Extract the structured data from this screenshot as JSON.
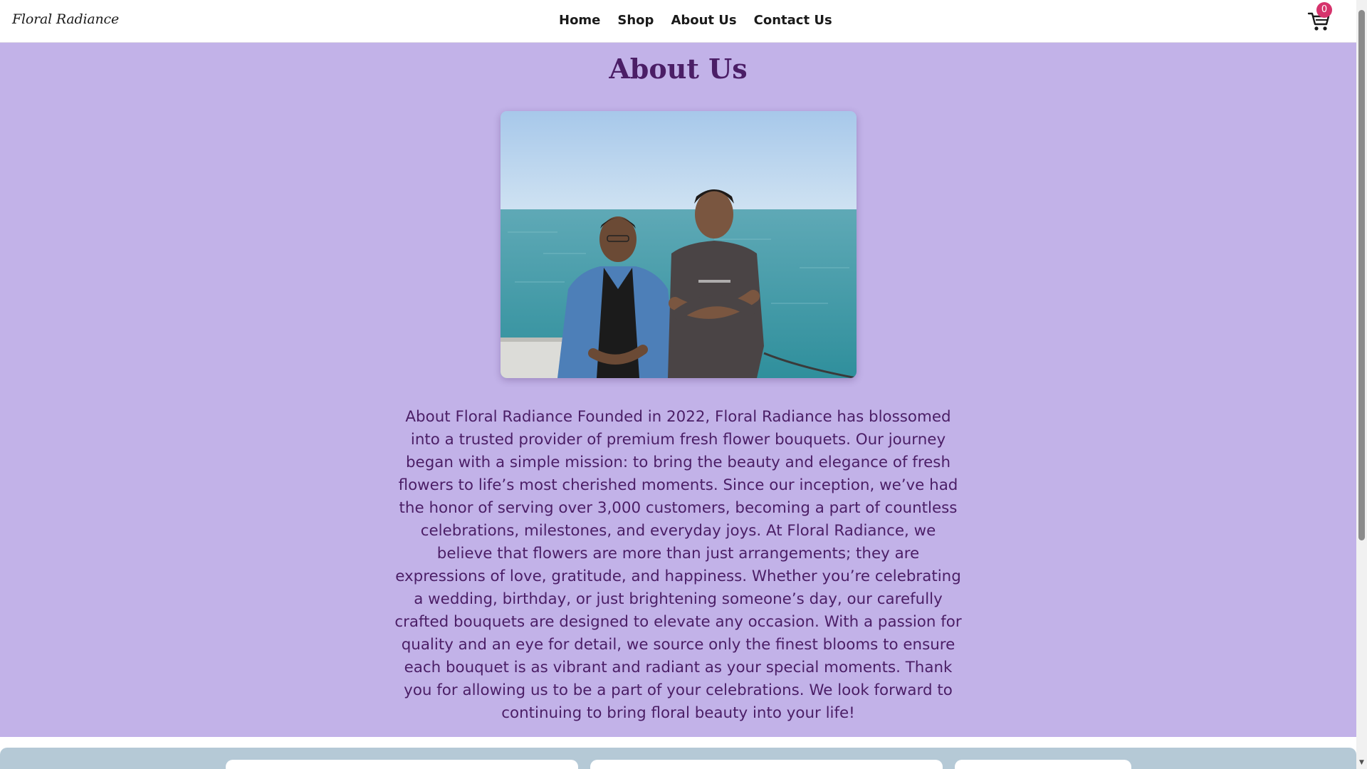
{
  "header": {
    "logo": "Floral Radiance",
    "nav": [
      "Home",
      "Shop",
      "About Us",
      "Contact Us"
    ],
    "cart_count": "0"
  },
  "about": {
    "title": "About Us",
    "photo_icon": "team-photo",
    "text": "About Floral Radiance Founded in 2022, Floral Radiance has blossomed into a trusted provider of premium fresh flower bouquets. Our journey began with a simple mission: to bring the beauty and elegance of fresh flowers to life’s most cherished moments. Since our inception, we’ve had the honor of serving over 3,000 customers, becoming a part of countless celebrations, milestones, and everyday joys. At Floral Radiance, we believe that flowers are more than just arrangements; they are expressions of love, gratitude, and happiness. Whether you’re celebrating a wedding, birthday, or just brightening someone’s day, our carefully crafted bouquets are designed to elevate any occasion. With a passion for quality and an eye for detail, we source only the finest blooms to ensure each bouquet is as vibrant and radiant as your special moments. Thank you for allowing us to be a part of your celebrations. We look forward to continuing to bring floral beauty into your life!"
  },
  "colors": {
    "about_bg": "#c2b2e8",
    "heading": "#4b1e66",
    "badge": "#d6336c",
    "next_section_bg": "#b5c9d6"
  }
}
